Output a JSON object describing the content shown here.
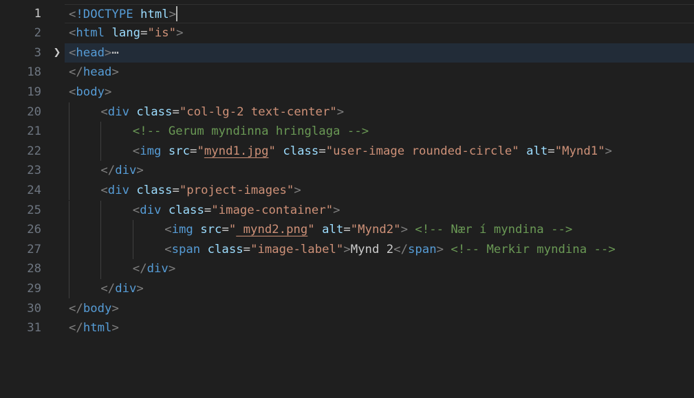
{
  "editor": {
    "lines": [
      {
        "number": "1",
        "tokens": [
          {
            "t": "punc",
            "v": "<"
          },
          {
            "t": "tag",
            "v": "!DOCTYPE"
          },
          {
            "t": "text",
            "v": " "
          },
          {
            "t": "attr",
            "v": "html"
          },
          {
            "t": "punc",
            "v": ">"
          }
        ]
      },
      {
        "number": "2",
        "tokens": [
          {
            "t": "punc",
            "v": "<"
          },
          {
            "t": "tag",
            "v": "html"
          },
          {
            "t": "text",
            "v": " "
          },
          {
            "t": "attr",
            "v": "lang"
          },
          {
            "t": "eq",
            "v": "="
          },
          {
            "t": "str",
            "v": "\"is\""
          },
          {
            "t": "punc",
            "v": ">"
          }
        ]
      },
      {
        "number": "3",
        "folded": true,
        "tokens": [
          {
            "t": "punc",
            "v": "<"
          },
          {
            "t": "tag",
            "v": "head"
          },
          {
            "t": "punc",
            "v": ">"
          },
          {
            "t": "fold",
            "v": "⋯"
          }
        ]
      },
      {
        "number": "18",
        "tokens": [
          {
            "t": "punc",
            "v": "</"
          },
          {
            "t": "tag",
            "v": "head"
          },
          {
            "t": "punc",
            "v": ">"
          }
        ]
      },
      {
        "number": "19",
        "tokens": [
          {
            "t": "punc",
            "v": "<"
          },
          {
            "t": "tag",
            "v": "body"
          },
          {
            "t": "punc",
            "v": ">"
          }
        ]
      },
      {
        "number": "20",
        "indent": 1,
        "tokens": [
          {
            "t": "punc",
            "v": "<"
          },
          {
            "t": "tag",
            "v": "div"
          },
          {
            "t": "text",
            "v": " "
          },
          {
            "t": "attr",
            "v": "class"
          },
          {
            "t": "eq",
            "v": "="
          },
          {
            "t": "str",
            "v": "\"col-lg-2 text-center\""
          },
          {
            "t": "punc",
            "v": ">"
          }
        ]
      },
      {
        "number": "21",
        "indent": 2,
        "tokens": [
          {
            "t": "com",
            "v": "<!-- Gerum myndinna hringlaga -->"
          }
        ]
      },
      {
        "number": "22",
        "indent": 2,
        "tokens": [
          {
            "t": "punc",
            "v": "<"
          },
          {
            "t": "tag",
            "v": "img"
          },
          {
            "t": "text",
            "v": " "
          },
          {
            "t": "attr",
            "v": "src"
          },
          {
            "t": "eq",
            "v": "="
          },
          {
            "t": "str",
            "v": "\""
          },
          {
            "t": "str-u",
            "v": "mynd1.jpg"
          },
          {
            "t": "str",
            "v": "\""
          },
          {
            "t": "text",
            "v": " "
          },
          {
            "t": "attr",
            "v": "class"
          },
          {
            "t": "eq",
            "v": "="
          },
          {
            "t": "str",
            "v": "\"user-image rounded-circle\""
          },
          {
            "t": "text",
            "v": " "
          },
          {
            "t": "attr",
            "v": "alt"
          },
          {
            "t": "eq",
            "v": "="
          },
          {
            "t": "str",
            "v": "\"Mynd1\""
          },
          {
            "t": "punc",
            "v": ">"
          }
        ]
      },
      {
        "number": "23",
        "indent": 1,
        "tokens": [
          {
            "t": "punc",
            "v": "</"
          },
          {
            "t": "tag",
            "v": "div"
          },
          {
            "t": "punc",
            "v": ">"
          }
        ]
      },
      {
        "number": "24",
        "indent": 1,
        "tokens": [
          {
            "t": "punc",
            "v": "<"
          },
          {
            "t": "tag",
            "v": "div"
          },
          {
            "t": "text",
            "v": " "
          },
          {
            "t": "attr",
            "v": "class"
          },
          {
            "t": "eq",
            "v": "="
          },
          {
            "t": "str",
            "v": "\"project-images\""
          },
          {
            "t": "punc",
            "v": ">"
          }
        ]
      },
      {
        "number": "25",
        "indent": 2,
        "tokens": [
          {
            "t": "punc",
            "v": "<"
          },
          {
            "t": "tag",
            "v": "div"
          },
          {
            "t": "text",
            "v": " "
          },
          {
            "t": "attr",
            "v": "class"
          },
          {
            "t": "eq",
            "v": "="
          },
          {
            "t": "str",
            "v": "\"image-container\""
          },
          {
            "t": "punc",
            "v": ">"
          }
        ]
      },
      {
        "number": "26",
        "indent": 3,
        "tokens": [
          {
            "t": "punc",
            "v": "<"
          },
          {
            "t": "tag",
            "v": "img"
          },
          {
            "t": "text",
            "v": " "
          },
          {
            "t": "attr",
            "v": "src"
          },
          {
            "t": "eq",
            "v": "="
          },
          {
            "t": "str",
            "v": "\""
          },
          {
            "t": "str-u",
            "v": " mynd2.png"
          },
          {
            "t": "str",
            "v": "\""
          },
          {
            "t": "text",
            "v": " "
          },
          {
            "t": "attr",
            "v": "alt"
          },
          {
            "t": "eq",
            "v": "="
          },
          {
            "t": "str",
            "v": "\"Mynd2\""
          },
          {
            "t": "punc",
            "v": ">"
          },
          {
            "t": "text",
            "v": " "
          },
          {
            "t": "com",
            "v": "<!-- Nær í myndina -->"
          }
        ]
      },
      {
        "number": "27",
        "indent": 3,
        "tokens": [
          {
            "t": "punc",
            "v": "<"
          },
          {
            "t": "tag",
            "v": "span"
          },
          {
            "t": "text",
            "v": " "
          },
          {
            "t": "attr",
            "v": "class"
          },
          {
            "t": "eq",
            "v": "="
          },
          {
            "t": "str",
            "v": "\"image-label\""
          },
          {
            "t": "punc",
            "v": ">"
          },
          {
            "t": "text",
            "v": "Mynd 2"
          },
          {
            "t": "punc",
            "v": "</"
          },
          {
            "t": "tag",
            "v": "span"
          },
          {
            "t": "punc",
            "v": ">"
          },
          {
            "t": "text",
            "v": " "
          },
          {
            "t": "com",
            "v": "<!-- Merkir myndina -->"
          }
        ]
      },
      {
        "number": "28",
        "indent": 2,
        "tokens": [
          {
            "t": "punc",
            "v": "</"
          },
          {
            "t": "tag",
            "v": "div"
          },
          {
            "t": "punc",
            "v": ">"
          }
        ]
      },
      {
        "number": "29",
        "indent": 1,
        "tokens": [
          {
            "t": "punc",
            "v": "</"
          },
          {
            "t": "tag",
            "v": "div"
          },
          {
            "t": "punc",
            "v": ">"
          }
        ]
      },
      {
        "number": "30",
        "tokens": [
          {
            "t": "punc",
            "v": "</"
          },
          {
            "t": "tag",
            "v": "body"
          },
          {
            "t": "punc",
            "v": ">"
          }
        ]
      },
      {
        "number": "31",
        "tokens": [
          {
            "t": "punc",
            "v": "</"
          },
          {
            "t": "tag",
            "v": "html"
          },
          {
            "t": "punc",
            "v": ">"
          }
        ]
      }
    ],
    "fold_icon": "chevron-right-icon",
    "colors": {
      "background": "#1f1f1f",
      "tag": "#569cd6",
      "attribute": "#9cdcfe",
      "string": "#ce9178",
      "comment": "#6a9955",
      "punctuation": "#808080"
    }
  }
}
